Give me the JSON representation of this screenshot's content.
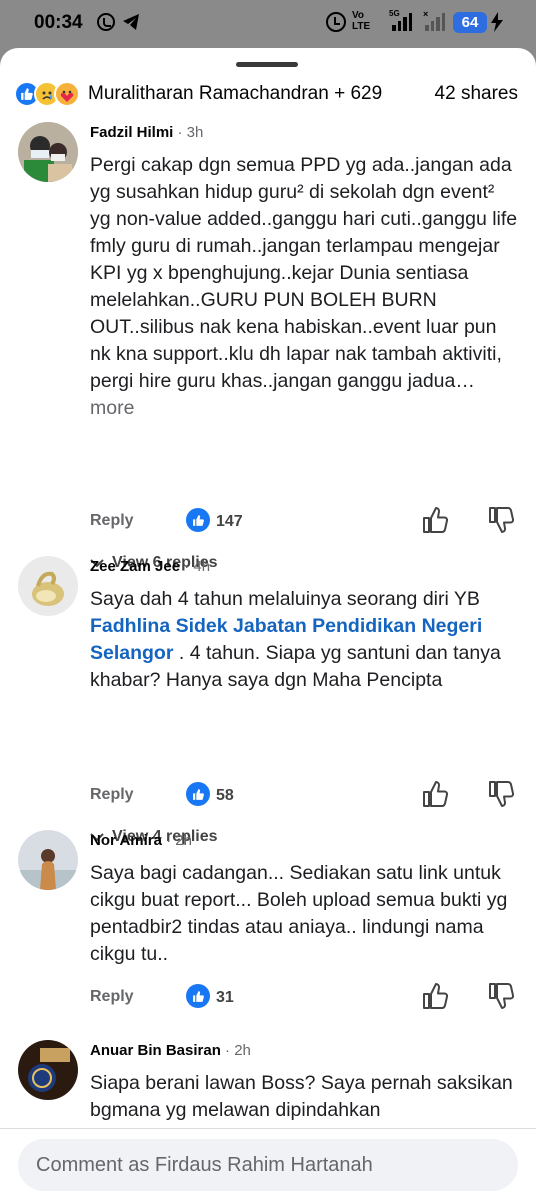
{
  "status_bar": {
    "time": "00:34",
    "volte": "Vo\nLTE",
    "network": "5G",
    "battery": "64"
  },
  "reactions": {
    "names": "Muralitharan Ramachandran + 629",
    "shares": "42 shares"
  },
  "comments": [
    {
      "author": "Fadzil Hilmi",
      "time": "· 3h",
      "text": "Pergi cakap dgn semua PPD yg ada..jangan ada yg susahkan hidup guru² di sekolah dgn event² yg non-value added..ganggu hari cuti..ganggu life fmly guru di rumah..jangan terlampau mengejar KPI yg x bpenghujung..kejar Dunia sentiasa melelahkan..GURU PUN BOLEH BURN OUT..silibus nak kena habiskan..event luar pun nk kna support..klu dh lapar nak tambah aktiviti, pergi hire guru khas..jangan ganggu jadua…",
      "more": "more",
      "reply": "Reply",
      "likes": "147",
      "view_replies": "View 6 replies"
    },
    {
      "author": "Zee Zam Jee",
      "time": "· 4h",
      "text_before": "Saya dah 4 tahun melaluinya seorang diri YB",
      "link": "Fadhlina Sidek Jabatan Pendidikan Negeri Selangor",
      "text_after": " . 4 tahun. Siapa yg santuni dan tanya khabar? Hanya saya dgn Maha Pencipta",
      "reply": "Reply",
      "likes": "58",
      "view_replies": "View 4 replies"
    },
    {
      "author": "Nor Amira",
      "time": "· 2h",
      "text": "Saya bagi cadangan... Sediakan satu link untuk cikgu buat report... Boleh upload semua bukti yg pentadbir2 tindas atau aniaya.. lindungi nama cikgu tu..",
      "reply": "Reply",
      "likes": "31"
    },
    {
      "author": "Anuar Bin Basiran",
      "time": "· 2h",
      "text": "Siapa berani lawan Boss? Saya pernah saksikan bgmana yg melawan dipindahkan"
    }
  ],
  "composer": {
    "placeholder": "Comment as Firdaus Rahim Hartanah"
  },
  "colors": {
    "accent": "#1877f2",
    "link": "#1565c0",
    "battery": "#2d6de0"
  }
}
